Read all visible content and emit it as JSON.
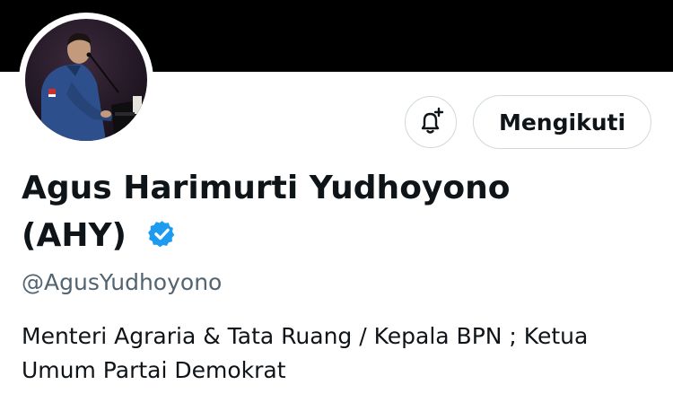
{
  "profile": {
    "name_line1": "Agus Harimurti Yudhoyono",
    "name_line2": "(AHY)",
    "handle": "@AgusYudhoyono",
    "bio": "Menteri Agraria & Tata Ruang / Kepala BPN ; Ketua Umum Partai Demokrat",
    "verified_icon": "verified-badge-icon",
    "verified_color": "#1d9bf0"
  },
  "actions": {
    "notify_icon": "bell-plus-icon",
    "follow_label": "Mengikuti"
  },
  "colors": {
    "banner": "#000000",
    "text_primary": "#0f1419",
    "text_secondary": "#536471",
    "border": "#cfd9de"
  }
}
